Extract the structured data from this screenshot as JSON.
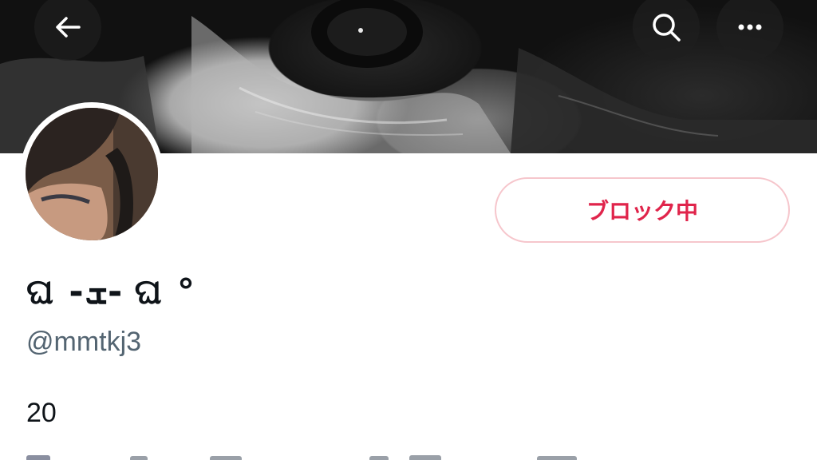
{
  "header": {
    "back_icon": "arrow-left-icon",
    "search_icon": "search-icon",
    "more_icon": "more-horizontal-icon"
  },
  "profile": {
    "display_name": "ଘ -ܫ- ଘ °",
    "handle": "@mmtkj3",
    "bio": "20",
    "block_button_label": "ブロック中"
  },
  "colors": {
    "blocked_red": "#e0244b",
    "blocked_border": "#f6c6cc",
    "text_primary": "#0f1419",
    "text_secondary": "#536471"
  }
}
